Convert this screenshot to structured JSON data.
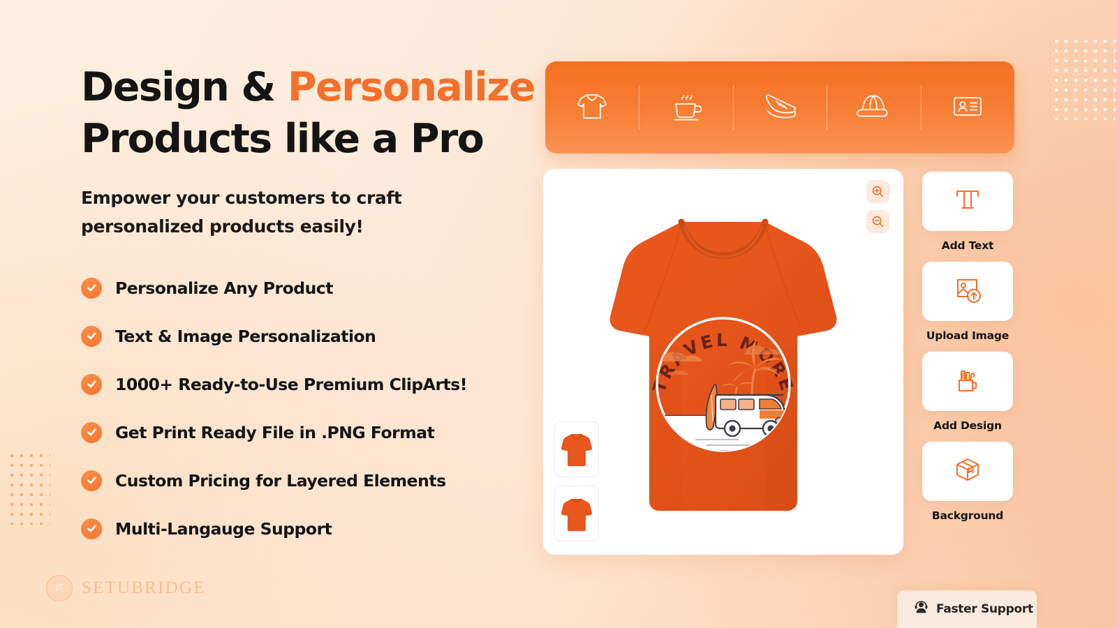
{
  "headline": {
    "line1_plain": "Design & ",
    "line1_accent": "Personalize",
    "line2": "Products like a Pro"
  },
  "subheading": "Empower your customers to craft personalized products easily!",
  "features": [
    {
      "label": "Personalize Any Product",
      "icon": "check-icon"
    },
    {
      "label": "Text & Image Personalization",
      "icon": "check-icon"
    },
    {
      "label": "1000+ Ready-to-Use Premium ClipArts!",
      "icon": "check-icon"
    },
    {
      "label": "Get Print Ready File in .PNG Format",
      "icon": "check-icon"
    },
    {
      "label": "Custom Pricing for Layered Elements",
      "icon": "check-icon"
    },
    {
      "label": "Multi-Langauge Support",
      "icon": "check-icon"
    }
  ],
  "watermark": {
    "text": "SETUBRIDGE",
    "icon": "setubridge-leaf-logo"
  },
  "product_toolbar": {
    "tabs": [
      {
        "name": "tshirt",
        "icon": "tshirt-icon"
      },
      {
        "name": "mug",
        "icon": "coffee-cup-icon"
      },
      {
        "name": "shoe",
        "icon": "sneaker-icon"
      },
      {
        "name": "cap",
        "icon": "cap-icon"
      },
      {
        "name": "card",
        "icon": "id-card-icon"
      }
    ]
  },
  "canvas": {
    "zoom_in_icon": "zoom-in-icon",
    "zoom_out_icon": "zoom-out-icon",
    "thumbnails": [
      {
        "name": "tshirt-front",
        "view": "front"
      },
      {
        "name": "tshirt-back",
        "view": "back"
      }
    ],
    "artwork": {
      "arc_text": "TRAVEL MORE",
      "scene": "vw-van-beach-palm-circle"
    },
    "product_color": "#e8571d"
  },
  "tools": [
    {
      "label": "Add Text",
      "icon": "text-t-icon"
    },
    {
      "label": "Upload Image",
      "icon": "upload-image-icon"
    },
    {
      "label": "Add Design",
      "icon": "pencil-cup-icon"
    },
    {
      "label": "Background",
      "icon": "box-icon"
    }
  ],
  "support": {
    "label": "Faster Support",
    "icon": "headset-agent-icon"
  },
  "colors": {
    "accent": "#f3702a",
    "toolbar_top": "#f4701f",
    "toolbar_bottom": "#fa9356",
    "page_bg": "#fdeada",
    "text_dark": "#141414",
    "product_orange": "#e8571d"
  }
}
